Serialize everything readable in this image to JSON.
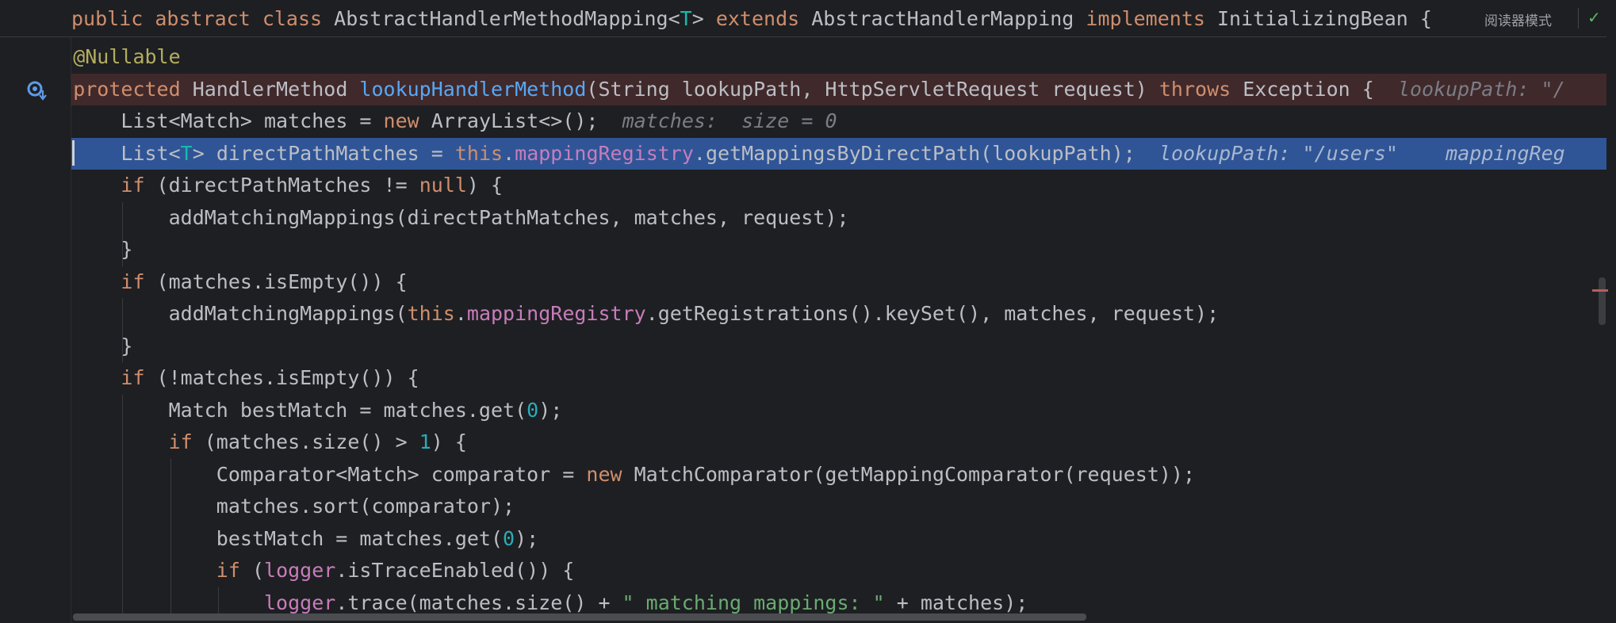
{
  "editor": {
    "reader_mode_label": "阅读器模式",
    "check_icon": "✓",
    "header": [
      {
        "t": "public abstract class ",
        "c": "kw"
      },
      {
        "t": "AbstractHandlerMethodMapping<",
        "c": ""
      },
      {
        "t": "T",
        "c": "tp"
      },
      {
        "t": "> ",
        "c": ""
      },
      {
        "t": "extends ",
        "c": "kw"
      },
      {
        "t": "AbstractHandlerMapping ",
        "c": ""
      },
      {
        "t": "implements ",
        "c": "kw"
      },
      {
        "t": "InitializingBean {",
        "c": ""
      }
    ],
    "lines": [
      {
        "indent": 1,
        "bg": "",
        "tokens": [
          {
            "t": "@Nullable",
            "c": "ann"
          }
        ]
      },
      {
        "indent": 1,
        "bg": "break",
        "tokens": [
          {
            "t": "protected ",
            "c": "kw"
          },
          {
            "t": "HandlerMethod ",
            "c": ""
          },
          {
            "t": "lookupHandlerMethod",
            "c": "fn"
          },
          {
            "t": "(String lookupPath, HttpServletRequest request) ",
            "c": ""
          },
          {
            "t": "throws ",
            "c": "kw"
          },
          {
            "t": "Exception {",
            "c": ""
          },
          {
            "t": "  lookupPath: \"/",
            "c": "hint"
          }
        ]
      },
      {
        "indent": 2,
        "bg": "",
        "tokens": [
          {
            "t": "List<Match> matches = ",
            "c": ""
          },
          {
            "t": "new ",
            "c": "kw"
          },
          {
            "t": "ArrayList<>();",
            "c": ""
          },
          {
            "t": "  matches:  size = 0",
            "c": "hint"
          }
        ]
      },
      {
        "indent": 2,
        "bg": "exec",
        "tokens": [
          {
            "t": "List<",
            "c": ""
          },
          {
            "t": "T",
            "c": "tp"
          },
          {
            "t": "> directPathMatches = ",
            "c": ""
          },
          {
            "t": "this",
            "c": "kw"
          },
          {
            "t": ".",
            "c": ""
          },
          {
            "t": "mappingRegistry",
            "c": "fld"
          },
          {
            "t": ".getMappingsByDirectPath(lookupPath);",
            "c": ""
          },
          {
            "t": "  lookupPath: \"/users\"    mappingReg",
            "c": "hint-sel"
          }
        ]
      },
      {
        "indent": 2,
        "bg": "",
        "tokens": [
          {
            "t": "if ",
            "c": "kw"
          },
          {
            "t": "(directPathMatches != ",
            "c": ""
          },
          {
            "t": "null",
            "c": "kw"
          },
          {
            "t": ") {",
            "c": ""
          }
        ]
      },
      {
        "indent": 3,
        "bg": "",
        "tokens": [
          {
            "t": "addMatchingMappings(directPathMatches, matches, request);",
            "c": ""
          }
        ]
      },
      {
        "indent": 2,
        "bg": "",
        "tokens": [
          {
            "t": "}",
            "c": ""
          }
        ]
      },
      {
        "indent": 2,
        "bg": "",
        "tokens": [
          {
            "t": "if ",
            "c": "kw"
          },
          {
            "t": "(matches.isEmpty()) {",
            "c": ""
          }
        ]
      },
      {
        "indent": 3,
        "bg": "",
        "tokens": [
          {
            "t": "addMatchingMappings(",
            "c": ""
          },
          {
            "t": "this",
            "c": "kw"
          },
          {
            "t": ".",
            "c": ""
          },
          {
            "t": "mappingRegistry",
            "c": "fld"
          },
          {
            "t": ".getRegistrations().keySet(), matches, request);",
            "c": ""
          }
        ]
      },
      {
        "indent": 2,
        "bg": "",
        "tokens": [
          {
            "t": "}",
            "c": ""
          }
        ]
      },
      {
        "indent": 2,
        "bg": "",
        "tokens": [
          {
            "t": "if ",
            "c": "kw"
          },
          {
            "t": "(!matches.isEmpty()) {",
            "c": ""
          }
        ]
      },
      {
        "indent": 3,
        "bg": "",
        "tokens": [
          {
            "t": "Match bestMatch = matches.get(",
            "c": ""
          },
          {
            "t": "0",
            "c": "num"
          },
          {
            "t": ");",
            "c": ""
          }
        ]
      },
      {
        "indent": 3,
        "bg": "",
        "tokens": [
          {
            "t": "if ",
            "c": "kw"
          },
          {
            "t": "(matches.size() > ",
            "c": ""
          },
          {
            "t": "1",
            "c": "num"
          },
          {
            "t": ") {",
            "c": ""
          }
        ]
      },
      {
        "indent": 4,
        "bg": "",
        "tokens": [
          {
            "t": "Comparator<Match> comparator = ",
            "c": ""
          },
          {
            "t": "new ",
            "c": "kw"
          },
          {
            "t": "MatchComparator(getMappingComparator(request));",
            "c": ""
          }
        ]
      },
      {
        "indent": 4,
        "bg": "",
        "tokens": [
          {
            "t": "matches.sort(comparator);",
            "c": ""
          }
        ]
      },
      {
        "indent": 4,
        "bg": "",
        "tokens": [
          {
            "t": "bestMatch = matches.get(",
            "c": ""
          },
          {
            "t": "0",
            "c": "num"
          },
          {
            "t": ");",
            "c": ""
          }
        ]
      },
      {
        "indent": 4,
        "bg": "",
        "tokens": [
          {
            "t": "if ",
            "c": "kw"
          },
          {
            "t": "(",
            "c": ""
          },
          {
            "t": "logger",
            "c": "fld"
          },
          {
            "t": ".isTraceEnabled()) {",
            "c": ""
          }
        ]
      },
      {
        "indent": 5,
        "bg": "",
        "tokens": [
          {
            "t": "logger",
            "c": "fld"
          },
          {
            "t": ".trace(matches.size() + ",
            "c": ""
          },
          {
            "t": "\" matching mappings: \"",
            "c": "str"
          },
          {
            "t": " + matches);",
            "c": ""
          }
        ]
      }
    ]
  }
}
